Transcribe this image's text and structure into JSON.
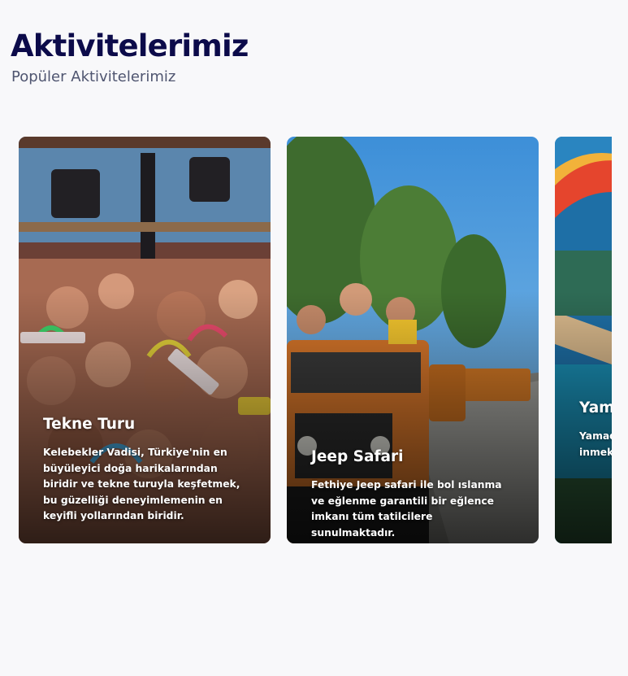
{
  "section": {
    "title": "Aktivitelerimiz",
    "subtitle": "Popüler Aktivitelerimiz"
  },
  "cards": [
    {
      "title": "Tekne Turu",
      "text": "Kelebekler Vadisi, Türkiye'nin en büyüleyici doğa harikalarından biridir ve tekne turuyla keşfetmek, bu güzelliği deneyimlemenin en keyifli yollarından biridir."
    },
    {
      "title": "Jeep Safari",
      "text": "Fethiye Jeep safari ile bol ıslanma ve eğlenme garantili bir eğlence imkanı tüm tatilcilere sunulmaktadır."
    },
    {
      "title": "Yam",
      "text": "Yamad derind bir tan aşağıy süzüle inmek"
    }
  ],
  "colors": {
    "page_background": "#f8f8fa",
    "title": "#0c0b4a",
    "subtitle": "#4f5570",
    "card_text": "#ffffff"
  }
}
